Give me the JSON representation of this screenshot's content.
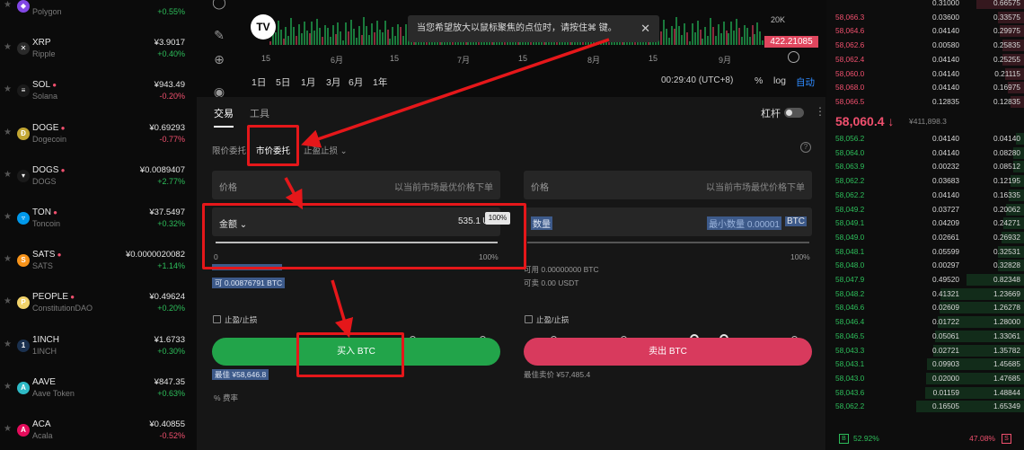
{
  "coins": [
    {
      "symbol": "",
      "name": "Polygon",
      "price": "",
      "change": "+0.55%",
      "dir": "pos",
      "icon_color": "#8247e5",
      "icon": "polygon-icon",
      "glyph": "◆",
      "hot": false
    },
    {
      "symbol": "XRP",
      "name": "Ripple",
      "price": "¥3.9017",
      "change": "+0.40%",
      "dir": "pos",
      "icon_color": "#2a2a2a",
      "icon": "xrp-icon",
      "glyph": "✕",
      "hot": false
    },
    {
      "symbol": "SOL",
      "name": "Solana",
      "price": "¥943.49",
      "change": "-0.20%",
      "dir": "neg",
      "icon_color": "#1a1a1a",
      "icon": "solana-icon",
      "glyph": "≡",
      "hot": true
    },
    {
      "symbol": "DOGE",
      "name": "Dogecoin",
      "price": "¥0.69293",
      "change": "-0.77%",
      "dir": "neg",
      "icon_color": "#c2a633",
      "icon": "doge-icon",
      "glyph": "Ð",
      "hot": true
    },
    {
      "symbol": "DOGS",
      "name": "DOGS",
      "price": "¥0.0089407",
      "change": "+2.77%",
      "dir": "pos",
      "icon_color": "#1a1a1a",
      "icon": "dogs-icon",
      "glyph": "▾",
      "hot": true
    },
    {
      "symbol": "TON",
      "name": "Toncoin",
      "price": "¥37.5497",
      "change": "+0.32%",
      "dir": "pos",
      "icon_color": "#0098ea",
      "icon": "ton-icon",
      "glyph": "▿",
      "hot": true
    },
    {
      "symbol": "SATS",
      "name": "SATS",
      "price": "¥0.0000020082",
      "change": "+1.14%",
      "dir": "pos",
      "icon_color": "#f7931a",
      "icon": "sats-icon",
      "glyph": "S",
      "hot": true
    },
    {
      "symbol": "PEOPLE",
      "name": "ConstitutionDAO",
      "price": "¥0.49624",
      "change": "+0.20%",
      "dir": "pos",
      "icon_color": "#f2d36b",
      "icon": "people-icon",
      "glyph": "P",
      "hot": true
    },
    {
      "symbol": "1INCH",
      "name": "1INCH",
      "price": "¥1.6733",
      "change": "+0.30%",
      "dir": "pos",
      "icon_color": "#1b314f",
      "icon": "1inch-icon",
      "glyph": "1",
      "hot": false
    },
    {
      "symbol": "AAVE",
      "name": "Aave Token",
      "price": "¥847.35",
      "change": "+0.63%",
      "dir": "pos",
      "icon_color": "#2ebac6",
      "icon": "aave-icon",
      "glyph": "A",
      "hot": false
    },
    {
      "symbol": "ACA",
      "name": "Acala",
      "price": "¥0.40855",
      "change": "-0.52%",
      "dir": "neg",
      "icon_color": "#e40c5b",
      "icon": "acala-icon",
      "glyph": "A",
      "hot": false
    }
  ],
  "chart": {
    "tv_logo": "TV",
    "tooltip": "当您希望放大以鼠标聚焦的点位时，请按住⌘ 键。",
    "vol_label": "20K",
    "price_tag": "422.21085",
    "xticks": [
      "15",
      "6月",
      "15",
      "7月",
      "15",
      "8月",
      "15",
      "9月"
    ],
    "timeframes": [
      "1日",
      "5日",
      "1月",
      "3月",
      "6月",
      "1年"
    ],
    "clock": "00:29:40 (UTC+8)",
    "pct": "%",
    "log": "log",
    "auto": "自动"
  },
  "panel": {
    "tabs": [
      "交易",
      "工具"
    ],
    "leverage": "杠杆",
    "order_types": [
      "限价委托",
      "市价委托",
      "止盈止损"
    ],
    "buy": {
      "price_label": "价格",
      "price_placeholder": "以当前市场最优价格下单",
      "amount_label": "金额",
      "amount_value": "535.1",
      "amount_unit": "US",
      "slider_tip": "100%",
      "slider_min": "0",
      "slider_max": "100%",
      "available": "0.00876791 BTC",
      "tpsl": "止盈/止损",
      "button": "买入 BTC",
      "best_price": "¥58,646.8",
      "fee": "费率"
    },
    "sell": {
      "price_label": "价格",
      "price_placeholder": "以当前市场最优价格下单",
      "qty_label": "数量",
      "qty_placeholder": "最小数量 0.00001",
      "qty_unit": "BTC",
      "slider_max": "100%",
      "available_line": "可用 0.00000000 BTC",
      "sellable_line": "可卖 0.00 USDT",
      "tpsl": "止盈/止损",
      "button": "卖出 BTC",
      "best_price": "最佳卖价 ¥57,485.4"
    }
  },
  "orderbook": {
    "asks": [
      {
        "p": "",
        "q": "0.31000",
        "t": "0.66575"
      },
      {
        "p": "58,066.3",
        "q": "0.03600",
        "t": "0.33575"
      },
      {
        "p": "58,064.6",
        "q": "0.04140",
        "t": "0.29975"
      },
      {
        "p": "58,062.6",
        "q": "0.00580",
        "t": "0.25835"
      },
      {
        "p": "58,062.4",
        "q": "0.04140",
        "t": "0.25255"
      },
      {
        "p": "58,060.0",
        "q": "0.04140",
        "t": "0.21115"
      },
      {
        "p": "58,068.0",
        "q": "0.04140",
        "t": "0.16975"
      },
      {
        "p": "58,066.5",
        "q": "0.12835",
        "t": "0.12835"
      }
    ],
    "mid_price": "58,060.4",
    "mid_arrow": "↓",
    "mid_sub": "¥411,898.3",
    "bids": [
      {
        "p": "58,056.2",
        "q": "0.04140",
        "t": "0.04140"
      },
      {
        "p": "58,064.0",
        "q": "0.04140",
        "t": "0.08280"
      },
      {
        "p": "58,063.9",
        "q": "0.00232",
        "t": "0.08512"
      },
      {
        "p": "58,062.2",
        "q": "0.03683",
        "t": "0.12195"
      },
      {
        "p": "58,062.2",
        "q": "0.04140",
        "t": "0.16335"
      },
      {
        "p": "58,049.2",
        "q": "0.03727",
        "t": "0.20062"
      },
      {
        "p": "58,049.1",
        "q": "0.04209",
        "t": "0.24271"
      },
      {
        "p": "58,049.0",
        "q": "0.02661",
        "t": "0.26932"
      },
      {
        "p": "58,048.1",
        "q": "0.05599",
        "t": "0.32531"
      },
      {
        "p": "58,048.0",
        "q": "0.00297",
        "t": "0.32828"
      },
      {
        "p": "58,047.9",
        "q": "0.49520",
        "t": "0.82348"
      },
      {
        "p": "58,048.2",
        "q": "0.41321",
        "t": "1.23669"
      },
      {
        "p": "58,046.6",
        "q": "0.02609",
        "t": "1.26278"
      },
      {
        "p": "58,046.4",
        "q": "0.01722",
        "t": "1.28000"
      },
      {
        "p": "58,046.5",
        "q": "0.05061",
        "t": "1.33061"
      },
      {
        "p": "58,043.3",
        "q": "0.02721",
        "t": "1.35782"
      },
      {
        "p": "58,043.1",
        "q": "0.09903",
        "t": "1.45685"
      },
      {
        "p": "58,043.0",
        "q": "0.02000",
        "t": "1.47685"
      },
      {
        "p": "58,043.6",
        "q": "0.01159",
        "t": "1.48844"
      },
      {
        "p": "58,062.2",
        "q": "0.16505",
        "t": "1.65349"
      }
    ],
    "buy_ratio": "52.92%",
    "sell_ratio": "47.08%",
    "buy_label": "B",
    "sell_label": "S"
  }
}
